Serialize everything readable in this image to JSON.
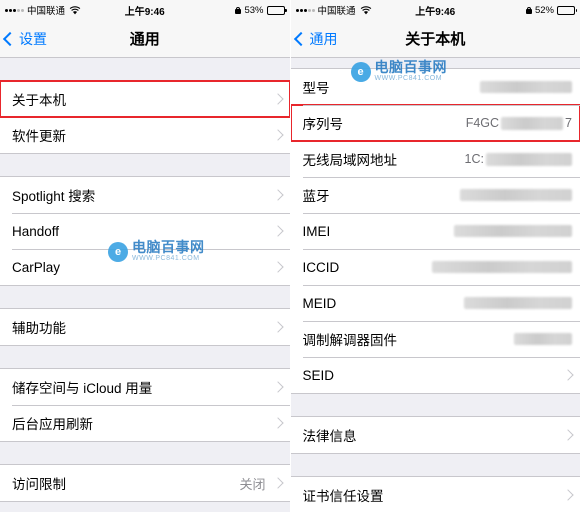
{
  "left": {
    "status": {
      "carrier": "中国联通",
      "time": "上午9:46",
      "battery_percent": "53%",
      "wifi_icon": "wifi-icon",
      "lock_icon": "rotation-lock-icon",
      "signal_icon": "signal-dots-icon"
    },
    "nav": {
      "back_label": "设置",
      "title": "通用",
      "back_icon": "chevron-left-icon"
    },
    "groups": [
      {
        "rows": [
          {
            "label": "关于本机",
            "value": "",
            "highlight": true
          },
          {
            "label": "软件更新",
            "value": "",
            "highlight": false
          }
        ]
      },
      {
        "rows": [
          {
            "label": "Spotlight 搜索",
            "value": "",
            "highlight": false
          },
          {
            "label": "Handoff",
            "value": "",
            "highlight": false
          },
          {
            "label": "CarPlay",
            "value": "",
            "highlight": false
          }
        ]
      },
      {
        "rows": [
          {
            "label": "辅助功能",
            "value": "",
            "highlight": false
          }
        ]
      },
      {
        "rows": [
          {
            "label": "储存空间与 iCloud 用量",
            "value": "",
            "highlight": false
          },
          {
            "label": "后台应用刷新",
            "value": "",
            "highlight": false
          }
        ]
      },
      {
        "rows": [
          {
            "label": "访问限制",
            "value": "关闭",
            "highlight": false
          }
        ]
      }
    ]
  },
  "right": {
    "status": {
      "carrier": "中国联通",
      "time": "上午9:46",
      "battery_percent": "52%",
      "wifi_icon": "wifi-icon",
      "lock_icon": "rotation-lock-icon",
      "signal_icon": "signal-dots-icon"
    },
    "nav": {
      "back_label": "通用",
      "title": "关于本机",
      "back_icon": "chevron-left-icon"
    },
    "groups": [
      {
        "rows": [
          {
            "label": "型号",
            "value": "",
            "redacted": true,
            "highlight": false
          },
          {
            "label": "序列号",
            "value": "F4GC",
            "value_suffix": "7",
            "redacted": true,
            "highlight": true
          },
          {
            "label": "无线局域网地址",
            "value": "1C:",
            "redacted": true,
            "highlight": false
          },
          {
            "label": "蓝牙",
            "value": "",
            "redacted": true,
            "highlight": false
          },
          {
            "label": "IMEI",
            "value": "",
            "redacted": true,
            "highlight": false
          },
          {
            "label": "ICCID",
            "value": "",
            "redacted": true,
            "highlight": false
          },
          {
            "label": "MEID",
            "value": "",
            "redacted": true,
            "highlight": false
          },
          {
            "label": "调制解调器固件",
            "value": "",
            "redacted": true,
            "highlight": false
          },
          {
            "label": "SEID",
            "value": "",
            "redacted": false,
            "highlight": false
          }
        ]
      },
      {
        "rows": [
          {
            "label": "法律信息",
            "value": "",
            "redacted": false,
            "highlight": false
          }
        ]
      },
      {
        "rows": [
          {
            "label": "证书信任设置",
            "value": "",
            "redacted": false,
            "highlight": false
          }
        ]
      }
    ]
  },
  "watermark": {
    "badge": "e",
    "main": "电脑百事网",
    "sub": "WWW.PC841.COM"
  }
}
